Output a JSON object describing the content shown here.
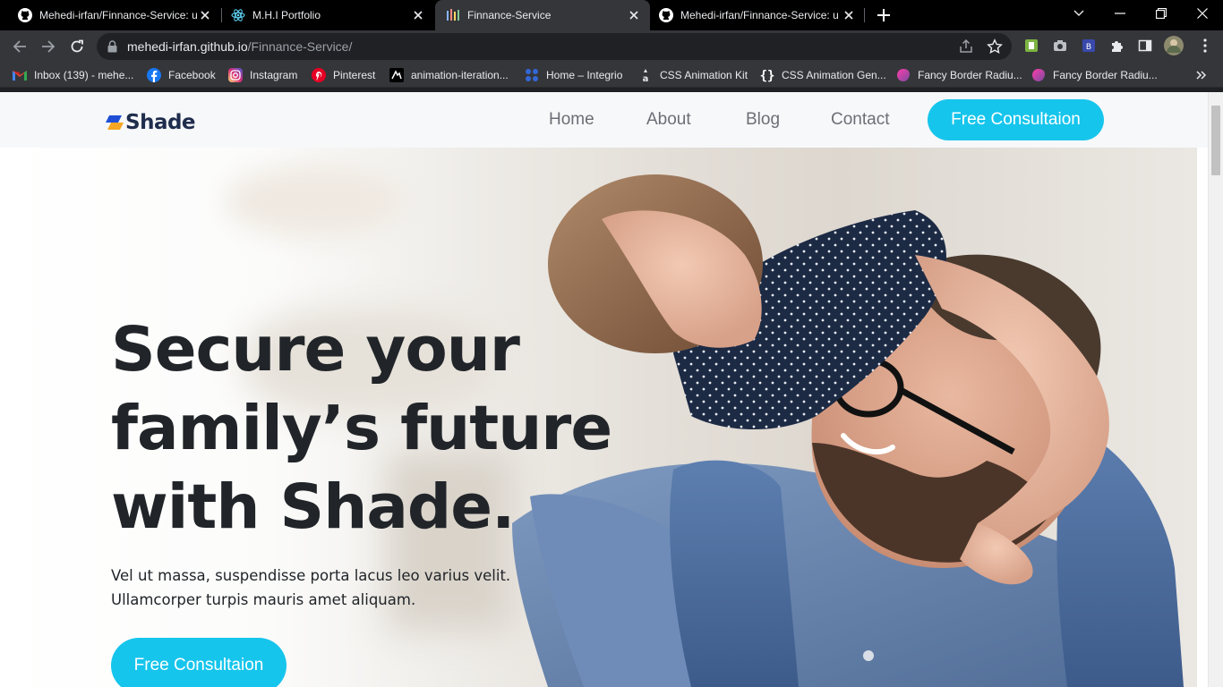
{
  "browser": {
    "tabs": [
      {
        "title": "Mehedi-irfan/Finnance-Service: u",
        "icon": "github-icon",
        "active": false
      },
      {
        "title": "M.H.I Portfolio",
        "icon": "react-icon",
        "active": false
      },
      {
        "title": "Finnance-Service",
        "icon": "finance-favicon",
        "active": true
      },
      {
        "title": "Mehedi-irfan/Finnance-Service: u",
        "icon": "github-icon",
        "active": false
      }
    ],
    "address": {
      "host": "mehedi-irfan.github.io",
      "path": "/Finnance-Service/"
    },
    "bookmarks": [
      {
        "label": "Inbox (139) - mehe...",
        "icon": "gmail-icon"
      },
      {
        "label": "Facebook",
        "icon": "facebook-icon"
      },
      {
        "label": "Instagram",
        "icon": "instagram-icon"
      },
      {
        "label": "Pinterest",
        "icon": "pinterest-icon"
      },
      {
        "label": "animation-iteration...",
        "icon": "mdn-icon"
      },
      {
        "label": "Home – Integrio",
        "icon": "integrio-icon"
      },
      {
        "label": "CSS Animation Kit",
        "icon": "css-kit-icon"
      },
      {
        "label": "CSS Animation Gen...",
        "icon": "braces-icon"
      },
      {
        "label": "Fancy Border Radiu...",
        "icon": "blob-icon"
      },
      {
        "label": "Fancy Border Radiu...",
        "icon": "blob-icon"
      }
    ]
  },
  "page": {
    "logo_text": "Shade",
    "nav": {
      "links": [
        "Home",
        "About",
        "Blog",
        "Contact"
      ],
      "cta": "Free Consultaion"
    },
    "hero": {
      "headline_lines": [
        "Secure your",
        "family’s future",
        "with Shade."
      ],
      "subtext_lines": [
        "Vel ut massa, suspendisse porta lacus leo varius velit.",
        "Ullamcorper turpis mauris amet aliquam."
      ],
      "cta": "Free Consultaion"
    }
  },
  "colors": {
    "accent": "#16c5ec",
    "logo_navy": "#1f2d4d",
    "logo_orange": "#f5a623",
    "heading": "#212529"
  }
}
